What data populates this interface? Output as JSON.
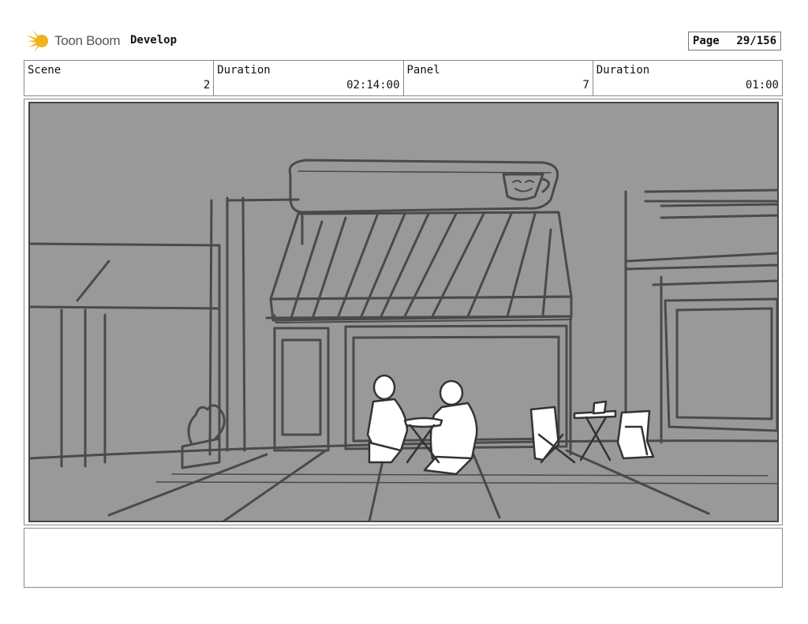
{
  "header": {
    "logo_text": "Toon Boom",
    "project": "Develop",
    "page_label": "Page",
    "page_value": "29/156"
  },
  "info": {
    "scene_label": "Scene",
    "scene_value": "2",
    "scene_duration_label": "Duration",
    "scene_duration_value": "02:14:00",
    "panel_label": "Panel",
    "panel_value": "7",
    "panel_duration_label": "Duration",
    "panel_duration_value": "01:00"
  },
  "panel": {
    "sign_text": "CAFE",
    "background_color": "#999999",
    "sketch_color": "#4a4a4a"
  },
  "notes": {
    "text": ""
  }
}
